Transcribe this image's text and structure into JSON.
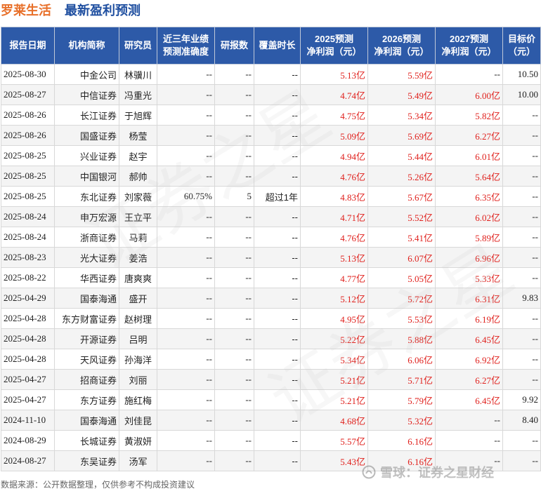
{
  "header": {
    "company": "罗莱生活",
    "section": "最新盈利预测"
  },
  "table": {
    "columns": [
      "报告日期",
      "机构简称",
      "研究员",
      "近三年业绩\n预测准确度",
      "研报数",
      "覆盖时长",
      "2025预测\n净利润（元）",
      "2026预测\n净利润（元）",
      "2027预测\n净利润（元）",
      "目标价\n（元）"
    ],
    "rows": [
      [
        "2025-08-30",
        "中金公司",
        "林骥川",
        "--",
        "--",
        "--",
        "5.13亿",
        "5.59亿",
        "--",
        "10.50"
      ],
      [
        "2025-08-27",
        "中信证券",
        "冯重光",
        "--",
        "--",
        "--",
        "4.74亿",
        "5.49亿",
        "6.00亿",
        "10.00"
      ],
      [
        "2025-08-26",
        "长江证券",
        "于旭辉",
        "--",
        "--",
        "--",
        "4.75亿",
        "5.34亿",
        "5.82亿",
        "--"
      ],
      [
        "2025-08-26",
        "国盛证券",
        "杨莹",
        "--",
        "--",
        "--",
        "5.09亿",
        "5.69亿",
        "6.27亿",
        "--"
      ],
      [
        "2025-08-25",
        "兴业证券",
        "赵宇",
        "--",
        "--",
        "--",
        "4.94亿",
        "5.44亿",
        "6.01亿",
        "--"
      ],
      [
        "2025-08-25",
        "中国银河",
        "郝帅",
        "--",
        "--",
        "--",
        "4.76亿",
        "5.26亿",
        "5.64亿",
        "--"
      ],
      [
        "2025-08-25",
        "东北证券",
        "刘家薇",
        "60.75%",
        "5",
        "超过1年",
        "4.83亿",
        "5.67亿",
        "6.35亿",
        "--"
      ],
      [
        "2025-08-24",
        "申万宏源",
        "王立平",
        "--",
        "--",
        "--",
        "4.71亿",
        "5.52亿",
        "6.02亿",
        "--"
      ],
      [
        "2025-08-24",
        "浙商证券",
        "马莉",
        "--",
        "--",
        "--",
        "4.76亿",
        "5.41亿",
        "5.89亿",
        "--"
      ],
      [
        "2025-08-23",
        "光大证券",
        "姜浩",
        "--",
        "--",
        "--",
        "5.13亿",
        "6.07亿",
        "6.96亿",
        "--"
      ],
      [
        "2025-08-22",
        "华西证券",
        "唐爽爽",
        "--",
        "--",
        "--",
        "4.77亿",
        "5.05亿",
        "5.33亿",
        "--"
      ],
      [
        "2025-04-29",
        "国泰海通",
        "盛开",
        "--",
        "--",
        "--",
        "5.12亿",
        "5.72亿",
        "6.31亿",
        "9.83"
      ],
      [
        "2025-04-28",
        "东方财富证券",
        "赵树理",
        "--",
        "--",
        "--",
        "4.95亿",
        "5.53亿",
        "6.19亿",
        "--"
      ],
      [
        "2025-04-28",
        "开源证券",
        "吕明",
        "--",
        "--",
        "--",
        "5.22亿",
        "5.88亿",
        "6.45亿",
        "--"
      ],
      [
        "2025-04-28",
        "天风证券",
        "孙海洋",
        "--",
        "--",
        "--",
        "5.34亿",
        "6.06亿",
        "6.92亿",
        "--"
      ],
      [
        "2025-04-27",
        "招商证券",
        "刘丽",
        "--",
        "--",
        "--",
        "5.21亿",
        "5.71亿",
        "6.27亿",
        "--"
      ],
      [
        "2025-04-27",
        "东方证券",
        "施红梅",
        "--",
        "--",
        "--",
        "5.21亿",
        "5.79亿",
        "6.45亿",
        "9.92"
      ],
      [
        "2024-11-10",
        "国泰海通",
        "刘佳昆",
        "--",
        "--",
        "--",
        "4.68亿",
        "5.32亿",
        "--",
        "8.40"
      ],
      [
        "2024-08-29",
        "长城证券",
        "黄淑妍",
        "--",
        "--",
        "--",
        "5.57亿",
        "6.16亿",
        "--",
        "--"
      ],
      [
        "2024-08-27",
        "东吴证券",
        "汤军",
        "--",
        "--",
        "--",
        "5.43亿",
        "6.16亿",
        "--",
        "--"
      ]
    ]
  },
  "watermark": {
    "brand_text": "雪球：证券之星财经",
    "background_text": "证券之星"
  },
  "footer": {
    "source_note": "数据来源：公开数据整理，仅供参考不构成投资建议"
  },
  "colors": {
    "header_bg": "#2d5aa8",
    "company_title": "#e8702a",
    "section_title": "#1f4fa0",
    "forecast_value": "#e0201c"
  },
  "icons": {
    "watermark": "snowball-logo-icon"
  }
}
